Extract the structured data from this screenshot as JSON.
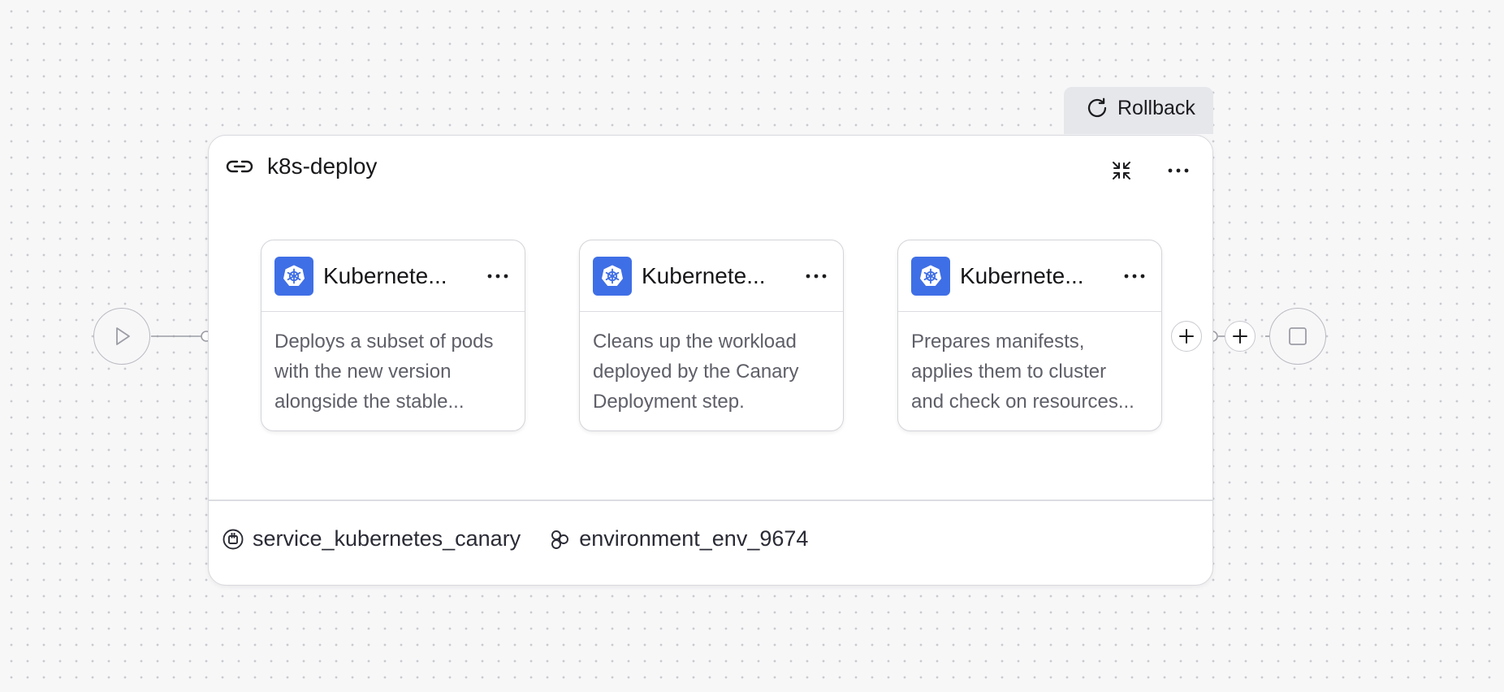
{
  "pipeline": {
    "rollback_label": "Rollback",
    "stage": {
      "title": "k8s-deploy",
      "service": "service_kubernetes_canary",
      "environment": "environment_env_9674"
    },
    "steps": [
      {
        "title": "Kubernete...",
        "description_lines": [
          "Deploys a subset of pods",
          "with the new version",
          "alongside the stable..."
        ]
      },
      {
        "title": "Kubernete...",
        "description_lines": [
          "Cleans up the workload",
          "deployed by the Canary",
          "Deployment step."
        ]
      },
      {
        "title": "Kubernete...",
        "description_lines": [
          "Prepares manifests,",
          "applies them to cluster",
          "and check on resources..."
        ]
      }
    ]
  },
  "icons": {
    "start": "play-icon",
    "end": "stop-icon",
    "rollback": "refresh-icon",
    "stage": "link-icon",
    "collapse": "collapse-icon",
    "more": "more-horizontal-icon",
    "step_logo": "kubernetes-icon",
    "service": "service-icon",
    "environment": "environment-icon",
    "add": "plus-icon"
  },
  "colors": {
    "canvas_background": "#f7f7f8",
    "kubernetes_blue": "#3f6fe6",
    "rollback_background": "#e6e7eb",
    "muted_text": "#5e5f68"
  }
}
